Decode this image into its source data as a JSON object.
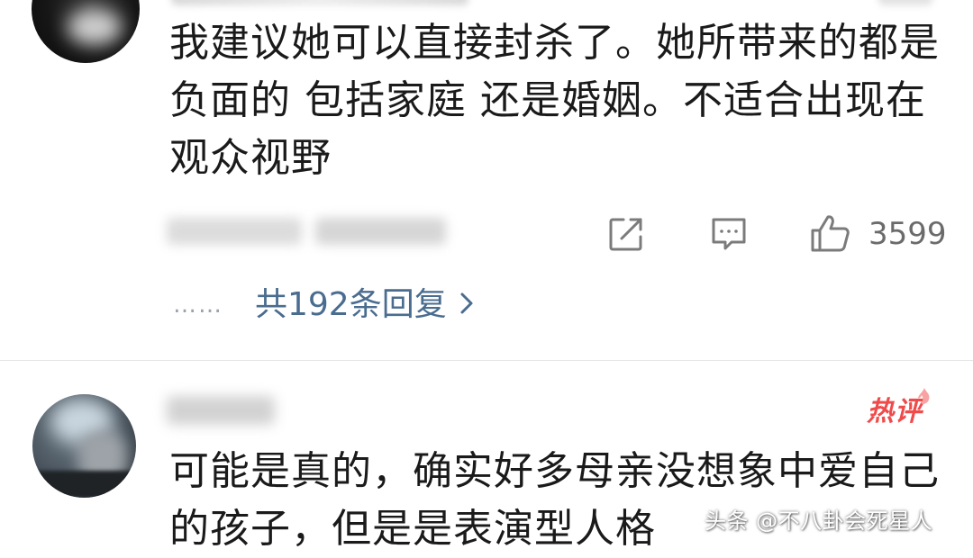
{
  "comments": [
    {
      "text_lines": [
        "我建议她可以直接封杀了。她所带来的都是",
        "负面的 包括家庭 还是婚姻。不适合出现在",
        "观众视野"
      ],
      "like_count": "3599",
      "replies_label": "共192条回复",
      "replies_dots": "……",
      "icons": [
        "share-icon",
        "comment-icon",
        "like-icon",
        "chevron-right-icon"
      ]
    },
    {
      "badge": "热评",
      "text_lines": [
        "可能是真的，确实好多母亲没想象中爱自己",
        "的孩子，但是是表演型人格"
      ]
    }
  ],
  "watermark": "头条 @不八卦会死星人",
  "colors": {
    "link": "#4a6c8f",
    "badge": "#f04b4b",
    "count": "#6b6b6b"
  }
}
